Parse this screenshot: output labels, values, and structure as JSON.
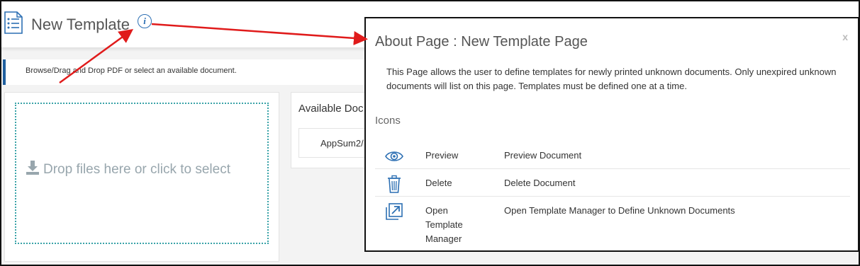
{
  "header": {
    "title": "New Template",
    "info_icon_glyph": "i"
  },
  "instruction": {
    "text": "Browse/Drag and Drop PDF or select an available document."
  },
  "dropzone": {
    "label": "Drop files here or click to select"
  },
  "available_documents": {
    "title": "Available Doc",
    "items": [
      {
        "label": "AppSum2/"
      }
    ]
  },
  "modal": {
    "title": "About Page : New Template Page",
    "close_label": "x",
    "description": "This Page allows the user to define templates for newly printed unknown documents. Only unexpired unknown documents will list on this page. Templates must be defined one at a time.",
    "icons_heading": "Icons",
    "icons": [
      {
        "icon": "eye-icon",
        "name": "Preview",
        "description": "Preview Document"
      },
      {
        "icon": "trash-icon",
        "name": "Delete",
        "description": "Delete Document"
      },
      {
        "icon": "open-external-icon",
        "name": "Open Template Manager",
        "description": "Open Template Manager to Define Unknown Documents"
      }
    ]
  },
  "colors": {
    "accent_blue": "#1f5f9e",
    "icon_blue": "#2c6fb3",
    "dropzone_border": "#3aa3a8",
    "annotation_arrow": "#e01b1b"
  }
}
